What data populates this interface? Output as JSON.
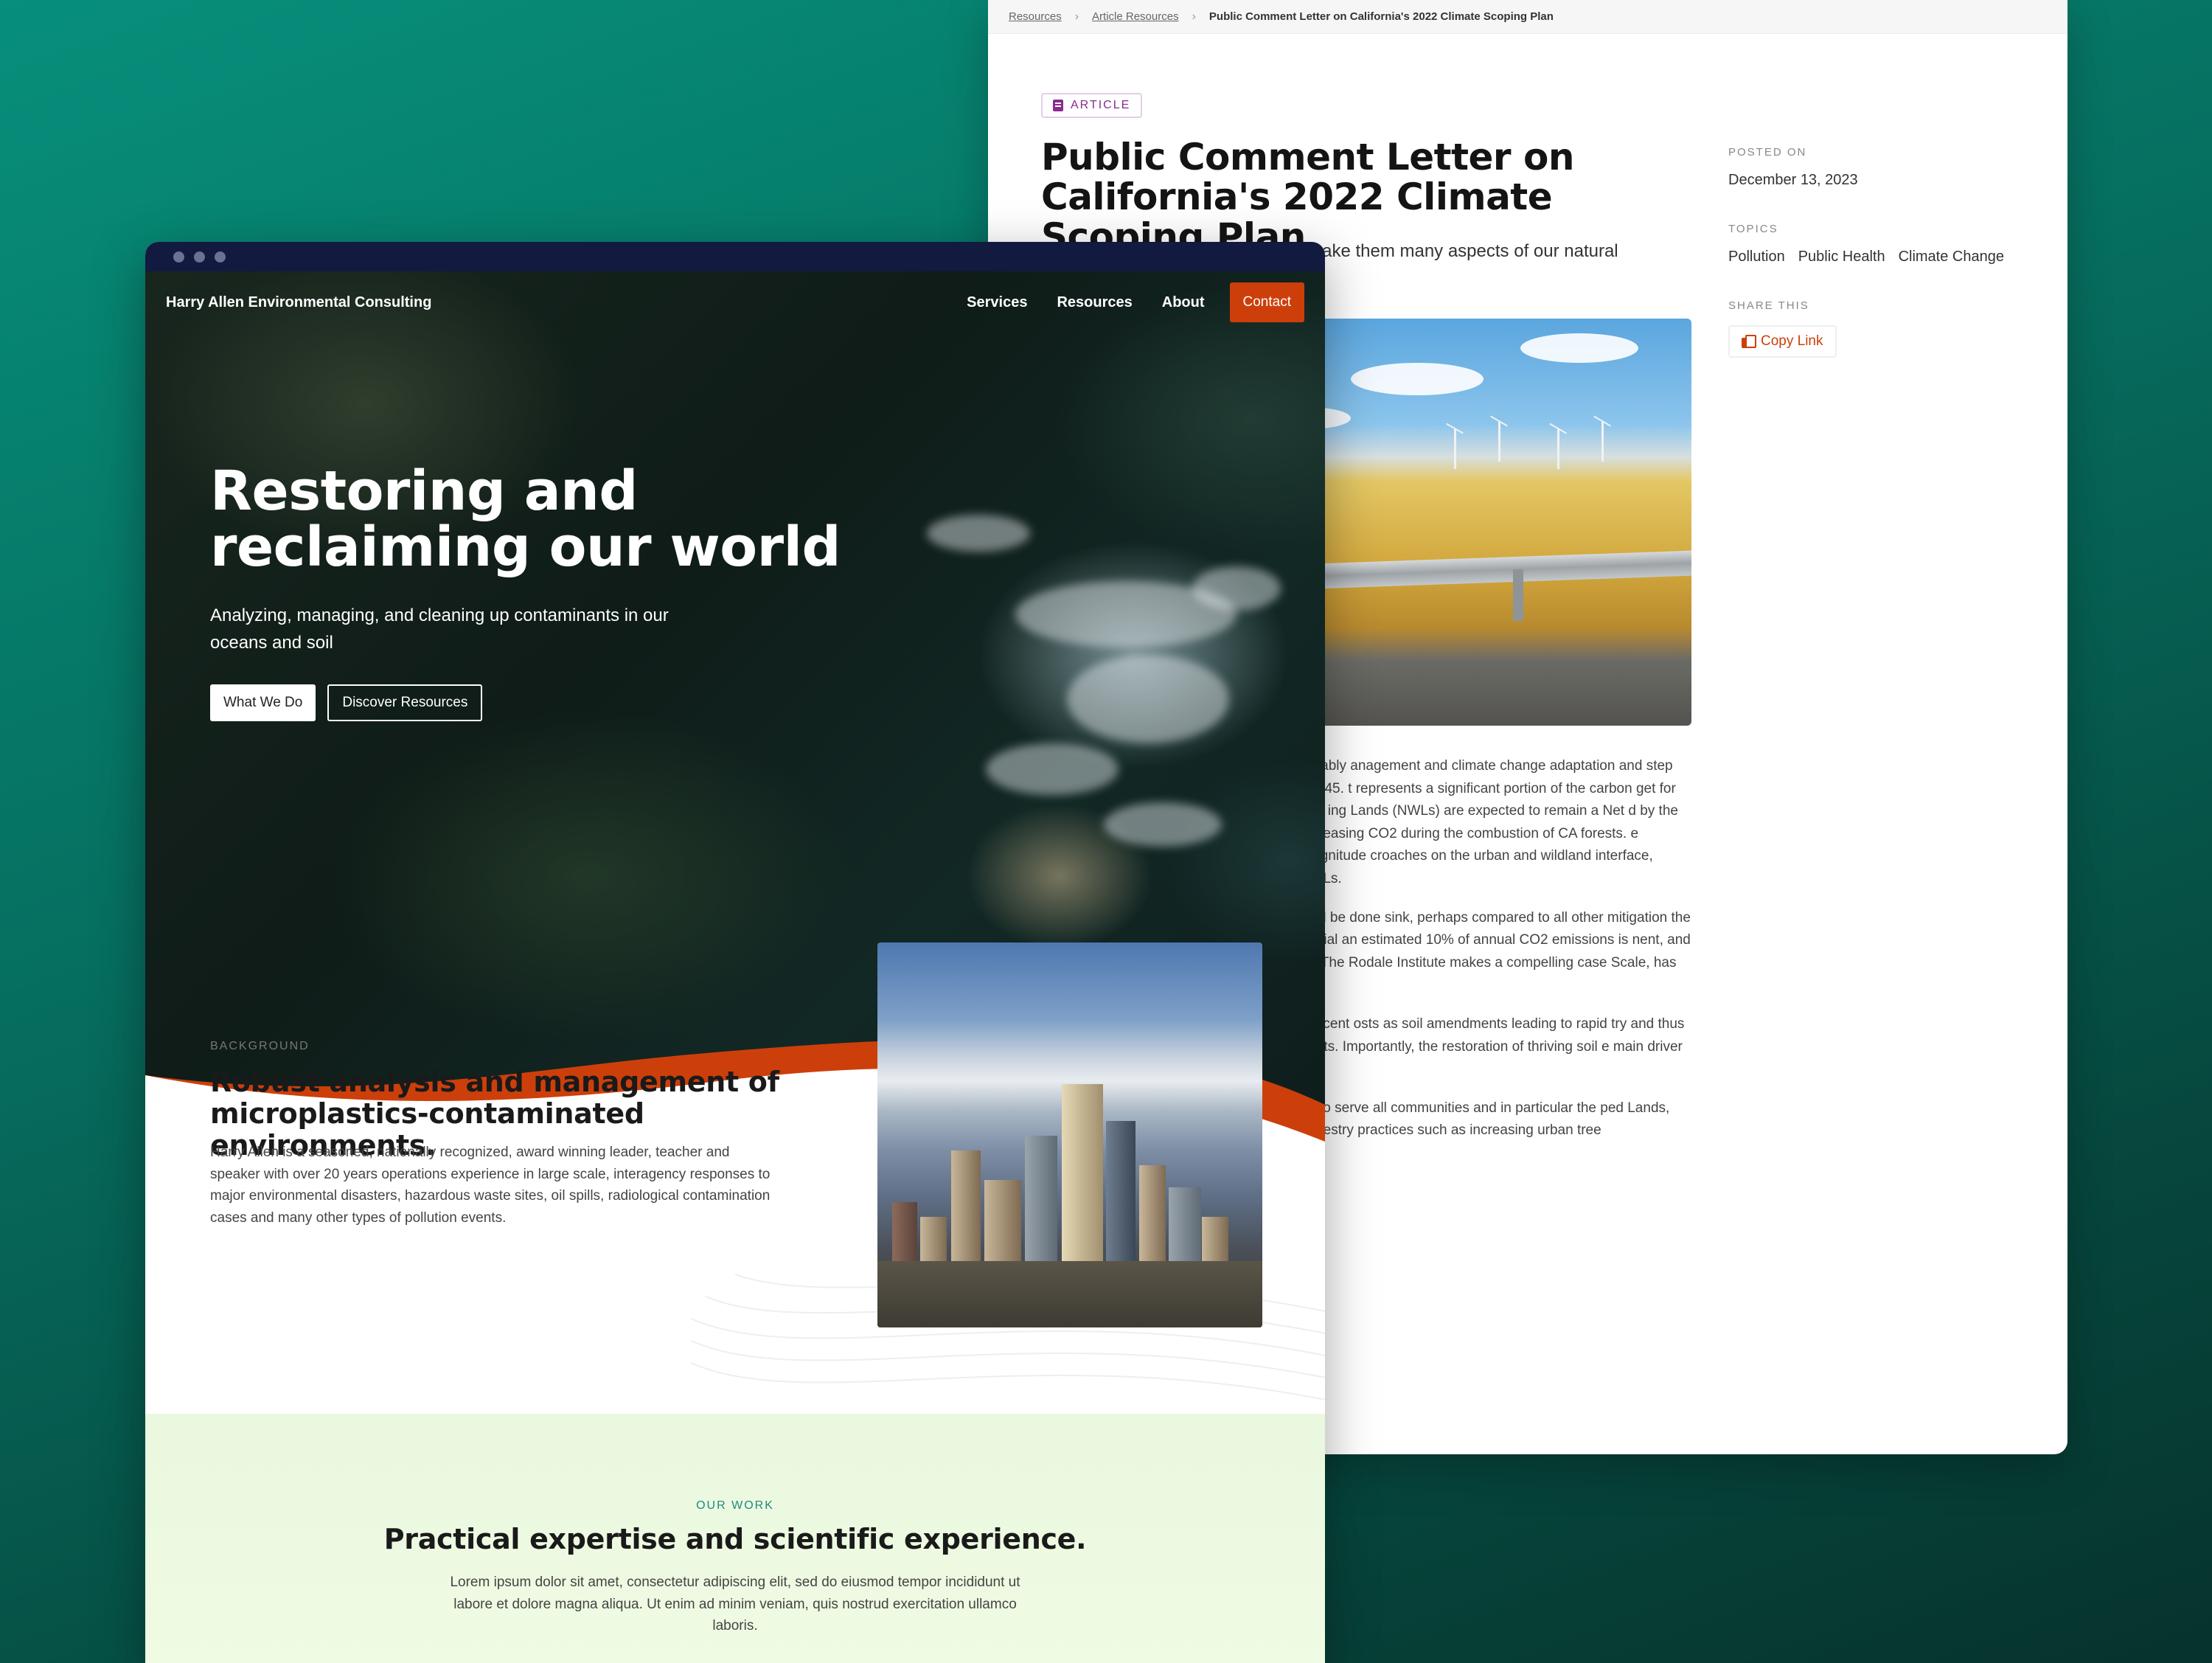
{
  "article": {
    "breadcrumb": {
      "items": [
        "Resources",
        "Article Resources"
      ],
      "current": "Public Comment Letter on California's 2022 Climate Scoping Plan"
    },
    "badge": "ARTICLE",
    "title": "Public Comment Letter on California's 2022 Climate Scoping Plan",
    "lead": "Natural and Working Lands could make them many aspects of our natural environment.",
    "body": [
      "fornia Air Resources Board authors have, notably anagement and climate change adaptation and step on the path to achieve carbon neutrality by 2045. t represents a significant portion of the carbon get for the State. Yet, even in the Proposed Scenario ing Lands (NWLs) are expected to remain a Net d by the high likelihood of continued mega wildfires releasing CO2 during the combustion of CA forests. e impairment of our burn-scarred soils. The magnitude croaches on the urban and wildland interface, developed lands - an important portion of NWLs.",
      "on sequestration, and climate planning should be done sink, perhaps compared to all other mitigation the degradation of agricultural soils due to industrial an estimated 10% of annual CO2 emissions is nent, and 30% of annual CO2 emissions can be verall. The Rodale Institute makes a compelling case Scale, has the potential to sequester all the world's",
      "n techniques has also been championed in recent osts as soil amendments leading to rapid try and thus mitigating erosion, a leading source of onments. Importantly, the restoration of thriving soil e main driver in carbon sequestration in agricultural",
      "- and long-term actions to accelerate carbon to serve all communities and in particular the ped Lands, the Scoping Plan and the NWL Climate an forestry practices such as increasing urban tree"
    ],
    "sidebar": {
      "posted_label": "POSTED ON",
      "posted_value": "December 13, 2023",
      "topics_label": "TOPICS",
      "topics": [
        "Pollution",
        "Public Health",
        "Climate Change"
      ],
      "share_label": "SHARE THIS",
      "copy_link": "Copy Link"
    }
  },
  "home": {
    "brand": "Harry Allen Environmental Consulting",
    "nav": [
      "Services",
      "Resources",
      "About"
    ],
    "contact": "Contact",
    "hero": {
      "title": "Restoring and reclaiming our world",
      "subtitle": "Analyzing, managing, and cleaning up contaminants in our oceans and soil",
      "primary_button": "What We Do",
      "secondary_button": "Discover Resources"
    },
    "background": {
      "eyebrow": "BACKGROUND",
      "title": "Robust analysis and management of microplastics-contaminated environments.",
      "text": "Harry Allen is a seasoned, nationally recognized, award winning leader, teacher and speaker with over 20 years operations experience in large scale, interagency responses to major environmental disasters, hazardous waste sites, oil spills, radiological contamination cases and many other types of pollution events."
    },
    "work": {
      "eyebrow": "OUR WORK",
      "title": "Practical expertise and scientific experience.",
      "text": "Lorem ipsum dolor sit amet, consectetur adipiscing elit, sed do eiusmod tempor incididunt ut labore et dolore magna aliqua. Ut enim ad minim veniam, quis nostrud exercitation ullamco laboris."
    }
  },
  "colors": {
    "accent": "#cc3f0b",
    "chrome": "#121a40",
    "badge": "#8a2b8f",
    "teal_bg": "#078f7b",
    "work_bg": "#eaf8e0"
  }
}
